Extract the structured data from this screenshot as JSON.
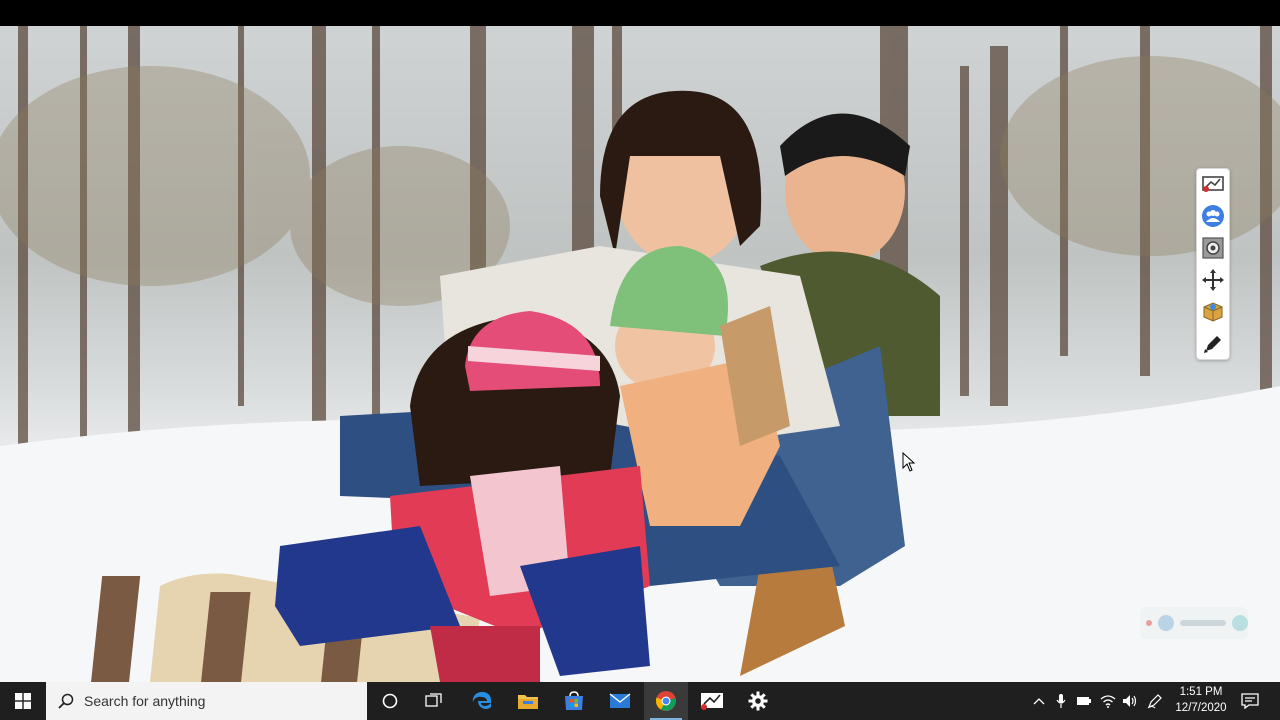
{
  "taskbar": {
    "search_placeholder": "Search for anything",
    "pinned": [
      {
        "name": "cortana-icon"
      },
      {
        "name": "task-view-icon"
      },
      {
        "name": "edge-icon"
      },
      {
        "name": "file-explorer-icon"
      },
      {
        "name": "store-icon"
      },
      {
        "name": "mail-icon"
      },
      {
        "name": "chrome-icon",
        "active": true
      },
      {
        "name": "screen-recorder-icon"
      },
      {
        "name": "settings-icon"
      }
    ],
    "clock": {
      "time": "1:51 PM",
      "date": "12/7/2020"
    }
  },
  "toolbox": {
    "tools": [
      "screen-annotate-icon",
      "participants-icon",
      "camera-icon",
      "move-icon",
      "box-icon",
      "pen-icon"
    ]
  },
  "colors": {
    "taskbar_bg": "#1f1f1f",
    "search_bg": "#f3f3f3",
    "active_indicator": "#7fb3e0"
  }
}
